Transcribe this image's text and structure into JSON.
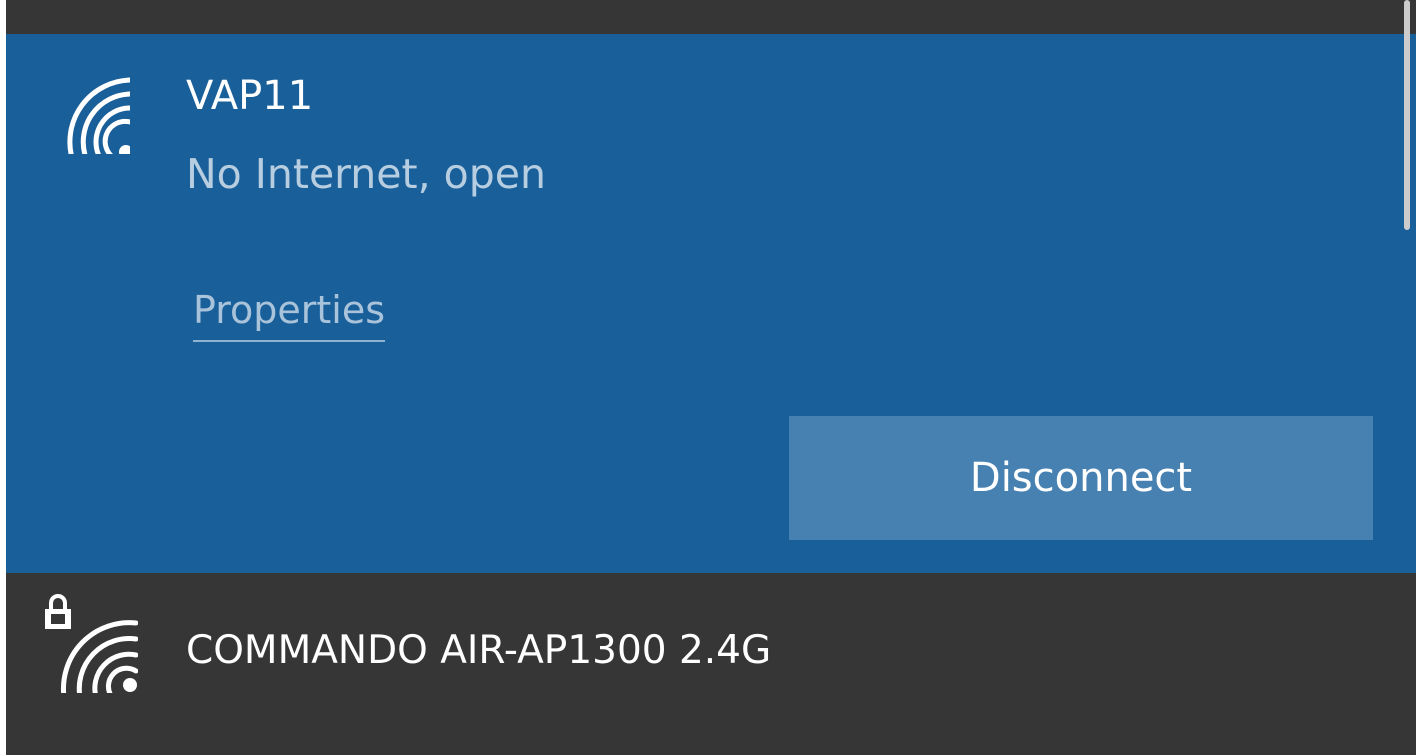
{
  "networks": [
    {
      "ssid": "VAP11",
      "status": "No Internet, open",
      "secured": false,
      "connected": true,
      "properties_label": "Properties",
      "action_label": "Disconnect"
    },
    {
      "ssid": "COMMANDO AIR-AP1300 2.4G",
      "secured": true,
      "connected": false
    }
  ],
  "icons": {
    "wifi": "wifi-signal-icon",
    "secured_wifi": "secured-wifi-icon",
    "lock": "lock-icon"
  },
  "colors": {
    "accent": "#195f9a",
    "button": "#4781b1",
    "background": "#363636",
    "text": "#ffffff"
  }
}
